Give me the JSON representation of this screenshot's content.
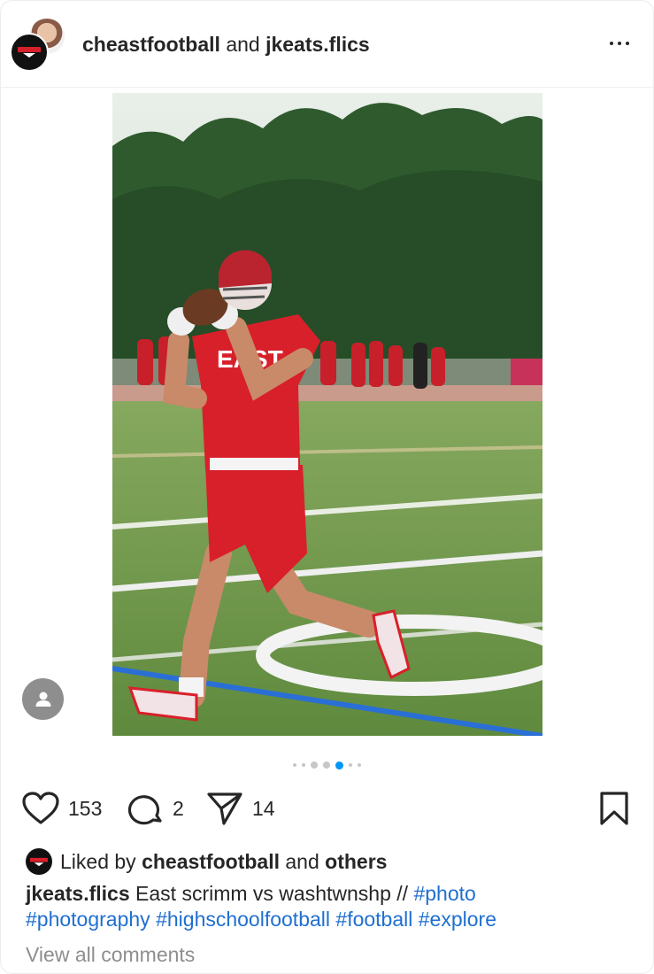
{
  "header": {
    "user_primary": "cheastfootball",
    "joiner": "and",
    "user_secondary": "jkeats.flics"
  },
  "carousel": {
    "count": 7,
    "active_index": 4
  },
  "actions": {
    "likes_count": "153",
    "comments_count": "2",
    "shares_count": "14"
  },
  "likes": {
    "prefix": "Liked by",
    "user": "cheastfootball",
    "joiner": "and",
    "others": "others"
  },
  "caption": {
    "user": "jkeats.flics",
    "text": "East scrimm vs washtwnshp //",
    "hashtags": [
      "#photo",
      "#photography",
      "#highschoolfootball",
      "#football",
      "#explore"
    ]
  },
  "photo": {
    "jersey_text": "EAST"
  },
  "comments": {
    "view_all_label": "View all comments"
  },
  "colors": {
    "accent": "#0095f6",
    "hashtag": "#1f6fd0",
    "jersey": "#d8202a"
  },
  "icons": [
    "heart-icon",
    "comment-icon",
    "share-icon",
    "bookmark-icon",
    "more-icon",
    "user-tag-icon"
  ]
}
